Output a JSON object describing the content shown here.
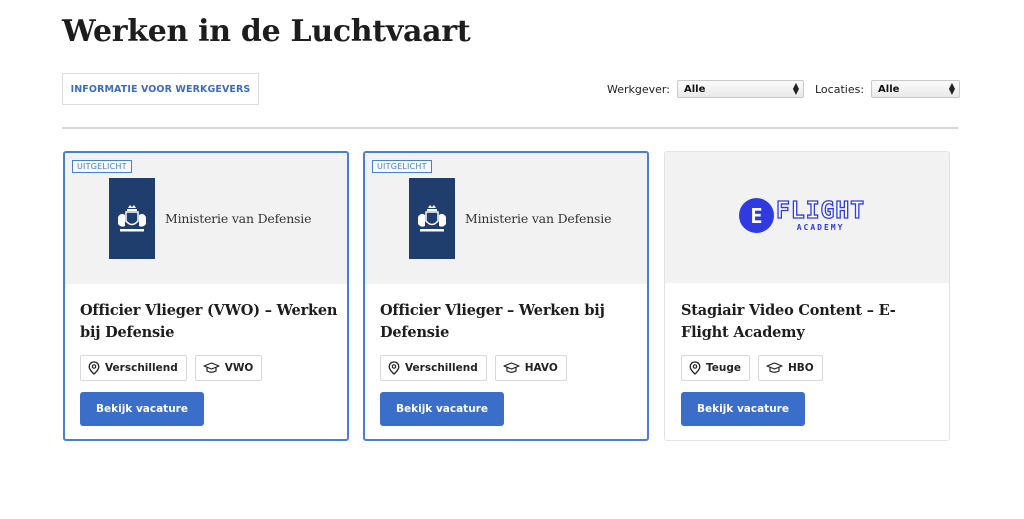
{
  "page": {
    "title": "Werken in de Luchtvaart"
  },
  "toolbar": {
    "info_button_label": "INFORMATIE VOOR WERKGEVERS"
  },
  "filters": {
    "employer": {
      "label": "Werkgever:",
      "value": "Alle"
    },
    "location": {
      "label": "Locaties:",
      "value": "Alle"
    }
  },
  "jobs": [
    {
      "featured": true,
      "badge": "UITGELICHT",
      "company_logo_text": "Ministerie van Defensie",
      "title": "Officier Vlieger (VWO) – Werken bij Defensie",
      "location": "Verschillend",
      "education": "VWO",
      "cta_label": "Bekijk vacature"
    },
    {
      "featured": true,
      "badge": "UITGELICHT",
      "company_logo_text": "Ministerie van Defensie",
      "title": "Officier Vlieger – Werken bij Defensie",
      "location": "Verschillend",
      "education": "HAVO",
      "cta_label": "Bekijk vacature"
    },
    {
      "featured": false,
      "company_logo_text": {
        "mark": "E",
        "name": "FLIGHT",
        "sub": "ACADEMY"
      },
      "title": "Stagiair Video Content – E-Flight Academy",
      "location": "Teuge",
      "education": "HBO",
      "cta_label": "Bekijk vacature"
    }
  ],
  "colors": {
    "accent": "#3a6ec8",
    "featured_border": "#4a7fc9",
    "defensie_blue": "#1f3e6e",
    "eflight_blue": "#2f3be0"
  }
}
